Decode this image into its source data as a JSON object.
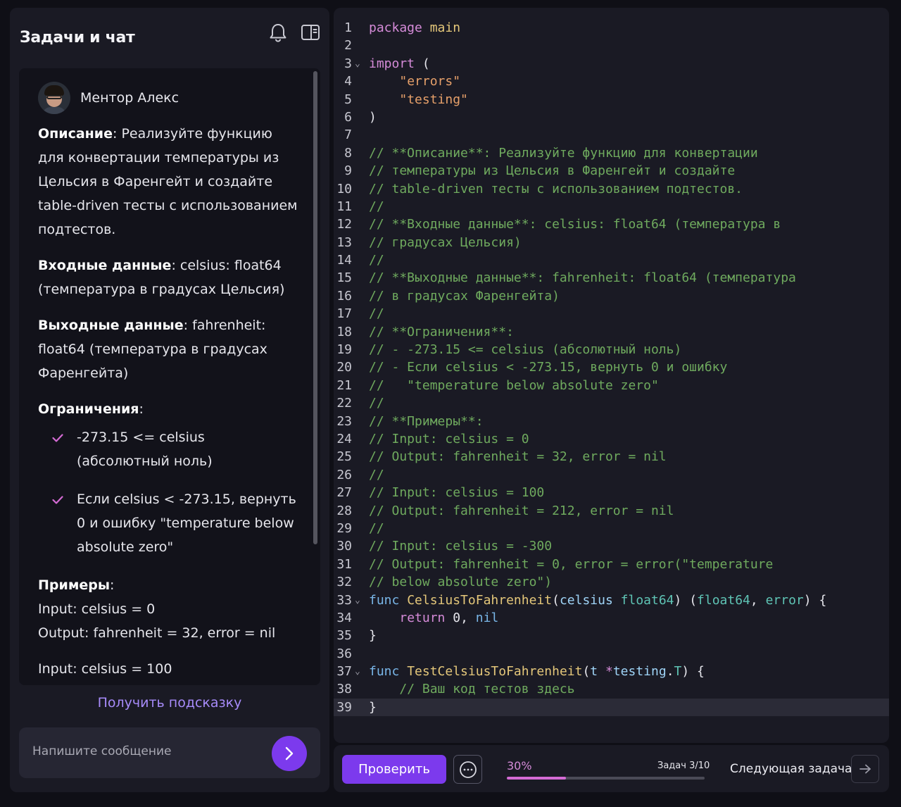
{
  "sidebar": {
    "title": "Задачи и чат",
    "icons": {
      "bell": "bell-icon",
      "panel": "panel-toggle-icon"
    }
  },
  "chat": {
    "mentor_name": "Ментор Алекс",
    "description_label": "Описание",
    "description_text": ": Реализуйте функцию для конвертации температуры из Цельсия в Фаренгейт и создайте table-driven тесты с использованием подтестов.",
    "input_label": "Входные данные",
    "input_text": ": celsius: float64 (температура в градусах Цельсия)",
    "output_label": "Выходные данные",
    "output_text": ": fahrenheit: float64 (температура в градусах Фаренгейта)",
    "constraints_label": "Ограничения",
    "constraints_colon": ":",
    "constraints": [
      "-273.15 <= celsius (абсолютный ноль)",
      "Если celsius < -273.15, вернуть 0 и ошибку \"temperature below absolute zero\""
    ],
    "examples_label": "Примеры",
    "examples_colon": ":",
    "example_lines": [
      "Input: celsius = 0",
      "Output: fahrenheit = 32, error = nil",
      "Input: celsius = 100"
    ],
    "hint_button": "Получить подсказку",
    "message_placeholder": "Напишите сообщение"
  },
  "editor": {
    "active_line": 39,
    "folded_lines": [
      3,
      33,
      37
    ],
    "lines": [
      [
        [
          "kw",
          "package"
        ],
        [
          "pl",
          " "
        ],
        [
          "fn",
          "main"
        ]
      ],
      [],
      [
        [
          "kw",
          "import"
        ],
        [
          "pl",
          " ("
        ]
      ],
      [
        [
          "pl",
          "    "
        ],
        [
          "str",
          "\"errors\""
        ]
      ],
      [
        [
          "pl",
          "    "
        ],
        [
          "str",
          "\"testing\""
        ]
      ],
      [
        [
          "pl",
          ")"
        ]
      ],
      [],
      [
        [
          "cm",
          "// **Описание**: Реализуйте функцию для конвертации"
        ]
      ],
      [
        [
          "cm",
          "// температуры из Цельсия в Фаренгейт и создайте"
        ]
      ],
      [
        [
          "cm",
          "// table-driven тесты с использованием подтестов."
        ]
      ],
      [
        [
          "cm",
          "//"
        ]
      ],
      [
        [
          "cm",
          "// **Входные данные**: celsius: float64 (температура в"
        ]
      ],
      [
        [
          "cm",
          "// градусах Цельсия)"
        ]
      ],
      [
        [
          "cm",
          "//"
        ]
      ],
      [
        [
          "cm",
          "// **Выходные данные**: fahrenheit: float64 (температура"
        ]
      ],
      [
        [
          "cm",
          "// в градусах Фаренгейта)"
        ]
      ],
      [
        [
          "cm",
          "//"
        ]
      ],
      [
        [
          "cm",
          "// **Ограничения**:"
        ]
      ],
      [
        [
          "cm",
          "// - -273.15 <= celsius (абсолютный ноль)"
        ]
      ],
      [
        [
          "cm",
          "// - Если celsius < -273.15, вернуть 0 и ошибку"
        ]
      ],
      [
        [
          "cm",
          "//   \"temperature below absolute zero\""
        ]
      ],
      [
        [
          "cm",
          "//"
        ]
      ],
      [
        [
          "cm",
          "// **Примеры**:"
        ]
      ],
      [
        [
          "cm",
          "// Input: celsius = 0"
        ]
      ],
      [
        [
          "cm",
          "// Output: fahrenheit = 32, error = nil"
        ]
      ],
      [
        [
          "cm",
          "//"
        ]
      ],
      [
        [
          "cm",
          "// Input: celsius = 100"
        ]
      ],
      [
        [
          "cm",
          "// Output: fahrenheit = 212, error = nil"
        ]
      ],
      [
        [
          "cm",
          "//"
        ]
      ],
      [
        [
          "cm",
          "// Input: celsius = -300"
        ]
      ],
      [
        [
          "cm",
          "// Output: fahrenheit = 0, error = error(\"temperature"
        ]
      ],
      [
        [
          "cm",
          "// below absolute zero\")"
        ]
      ],
      [
        [
          "nb",
          "func"
        ],
        [
          "pl",
          " "
        ],
        [
          "fn",
          "CelsiusToFahrenheit"
        ],
        [
          "pl",
          "("
        ],
        [
          "id",
          "celsius"
        ],
        [
          "pl",
          " "
        ],
        [
          "ty",
          "float64"
        ],
        [
          "pl",
          ") ("
        ],
        [
          "ty",
          "float64"
        ],
        [
          "pl",
          ", "
        ],
        [
          "ty",
          "error"
        ],
        [
          "pl",
          ") {"
        ]
      ],
      [
        [
          "pl",
          "    "
        ],
        [
          "kw",
          "return"
        ],
        [
          "pl",
          " "
        ],
        [
          "pl",
          "0"
        ],
        [
          "pl",
          ", "
        ],
        [
          "nb",
          "nil"
        ]
      ],
      [
        [
          "pl",
          "}"
        ]
      ],
      [],
      [
        [
          "nb",
          "func"
        ],
        [
          "pl",
          " "
        ],
        [
          "fn",
          "TestCelsiusToFahrenheit"
        ],
        [
          "pl",
          "("
        ],
        [
          "id",
          "t"
        ],
        [
          "pl",
          " "
        ],
        [
          "kw",
          "*"
        ],
        [
          "id",
          "testing"
        ],
        [
          "pl",
          "."
        ],
        [
          "ty",
          "T"
        ],
        [
          "pl",
          ") {"
        ]
      ],
      [
        [
          "pl",
          "    "
        ],
        [
          "cm",
          "// Ваш код тестов здесь"
        ]
      ],
      [
        [
          "pl",
          "}"
        ]
      ]
    ]
  },
  "footer": {
    "check_button": "Проверить",
    "more_icon": "chat-bubble-dots-icon",
    "progress_label": "30%",
    "progress_value": 0.3,
    "task_counter": "Задач 3/10",
    "next_task_label": "Следующая задача",
    "next_icon": "arrow-right-icon",
    "accent": "#7c3aed",
    "progress_color": "#d46bd4"
  }
}
